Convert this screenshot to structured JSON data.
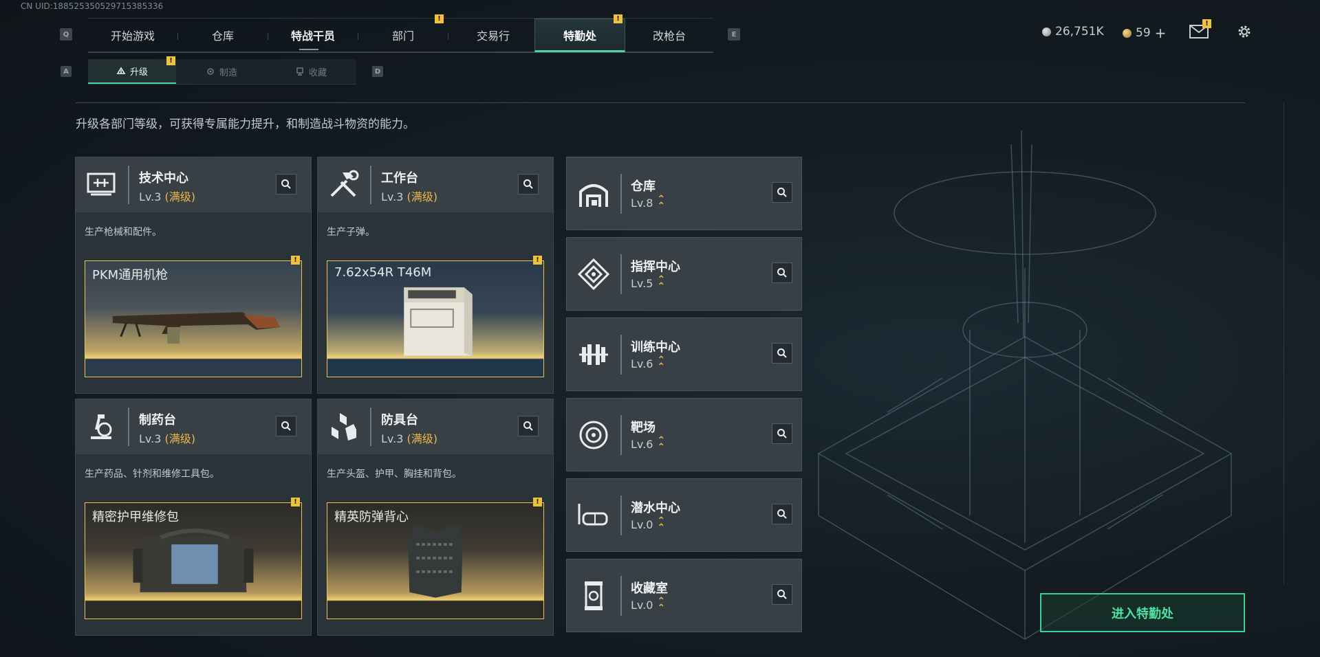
{
  "uid_text": "CN UID:18852535052971538533​6",
  "nav": {
    "left_key": "Q",
    "right_key": "E",
    "tabs": [
      {
        "label": "开始游戏"
      },
      {
        "label": "仓库"
      },
      {
        "label": "特战干员"
      },
      {
        "label": "部门"
      },
      {
        "label": "交易行"
      },
      {
        "label": "特勤处"
      },
      {
        "label": "改枪台"
      }
    ],
    "active_tab": "特勤处",
    "alert_glyph": "!"
  },
  "subnav": {
    "left_key": "A",
    "right_key": "D",
    "tabs": [
      {
        "label": "升级"
      },
      {
        "label": "制造"
      },
      {
        "label": "收藏"
      }
    ],
    "active_tab": "升级"
  },
  "resources": {
    "currency1": "26,751K",
    "currency2": "59",
    "add_glyph": "+"
  },
  "description": "升级各部门等级，可获得专属能力提升，和制造战斗物资的能力。",
  "departments": [
    {
      "name": "技术中心",
      "level": "Lv.3",
      "max": "(满级)",
      "desc": "生产枪械和配件。",
      "product": "PKM通用机枪",
      "icon": "tech-center-icon"
    },
    {
      "name": "工作台",
      "level": "Lv.3",
      "max": "(满级)",
      "desc": "生产子弹。",
      "product": "7.62x54R T46M",
      "icon": "workbench-icon"
    },
    {
      "name": "制药台",
      "level": "Lv.3",
      "max": "(满级)",
      "desc": "生产药品、针剂和维修工具包。",
      "product": "精密护甲维修包",
      "icon": "pharmacy-icon"
    },
    {
      "name": "防具台",
      "level": "Lv.3",
      "max": "(满级)",
      "desc": "生产头盔、护甲、胸挂和背包。",
      "product": "精英防弹背心",
      "icon": "armor-bench-icon"
    }
  ],
  "facilities": [
    {
      "name": "仓库",
      "level": "Lv.8",
      "icon": "storage-icon"
    },
    {
      "name": "指挥中心",
      "level": "Lv.5",
      "icon": "command-center-icon"
    },
    {
      "name": "训练中心",
      "level": "Lv.6",
      "icon": "training-center-icon"
    },
    {
      "name": "靶场",
      "level": "Lv.6",
      "icon": "shooting-range-icon"
    },
    {
      "name": "潜水中心",
      "level": "Lv.0",
      "icon": "diving-center-icon"
    },
    {
      "name": "收藏室",
      "level": "Lv.0",
      "icon": "collection-room-icon"
    }
  ],
  "enter_button": "进入特勤处",
  "colors": {
    "accent": "#4fd1a1",
    "gold": "#e9b94a",
    "alert": "#f0c23b"
  }
}
